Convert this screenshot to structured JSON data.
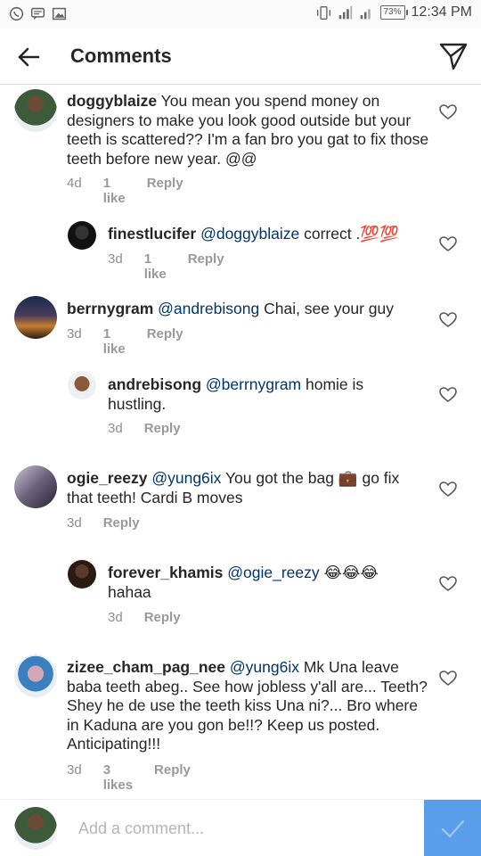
{
  "status_bar": {
    "battery": "73%",
    "time": "12:34 PM"
  },
  "header": {
    "title": "Comments"
  },
  "comments": [
    {
      "user": "doggyblaize",
      "mention": "",
      "text": " You mean you spend money on designers to make you look good outside but your teeth is scattered?? I'm a fan bro you gat to fix those teeth before new year. @@",
      "age": "4d",
      "likes": "1 like",
      "reply": "Reply"
    },
    {
      "user": "finestlucifer",
      "mention": "@doggyblaize",
      "text": " correct .💯💯",
      "age": "3d",
      "likes": "1 like",
      "reply": "Reply"
    },
    {
      "user": "berrnygram",
      "mention": "@andrebisong",
      "text": " Chai, see your guy",
      "age": "3d",
      "likes": "1 like",
      "reply": "Reply"
    },
    {
      "user": "andrebisong",
      "mention": "@berrnygram",
      "text": " homie is hustling.",
      "age": "3d",
      "likes": "",
      "reply": "Reply"
    },
    {
      "user": "ogie_reezy",
      "mention": "@yung6ix",
      "text": " You got the bag 💼 go fix that teeth! Cardi B moves",
      "age": "3d",
      "likes": "",
      "reply": "Reply"
    },
    {
      "user": "forever_khamis",
      "mention": "@ogie_reezy",
      "text": " 😂😂😂 hahaa",
      "age": "3d",
      "likes": "",
      "reply": "Reply"
    },
    {
      "user": "zizee_cham_pag_nee",
      "mention": "@yung6ix",
      "text": " Mk Una leave baba teeth abeg.. See how jobless y'all are... Teeth?  Shey he de use the teeth kiss Una ni?... Bro where in Kaduna are you gon be!!? Keep us posted. Anticipating!!!",
      "age": "3d",
      "likes": "3 likes",
      "reply": "Reply"
    }
  ],
  "composer": {
    "placeholder": "Add a comment..."
  },
  "colors": {
    "accent": "#5a9de8",
    "mention": "#003569",
    "meta": "#8e8e8e"
  }
}
